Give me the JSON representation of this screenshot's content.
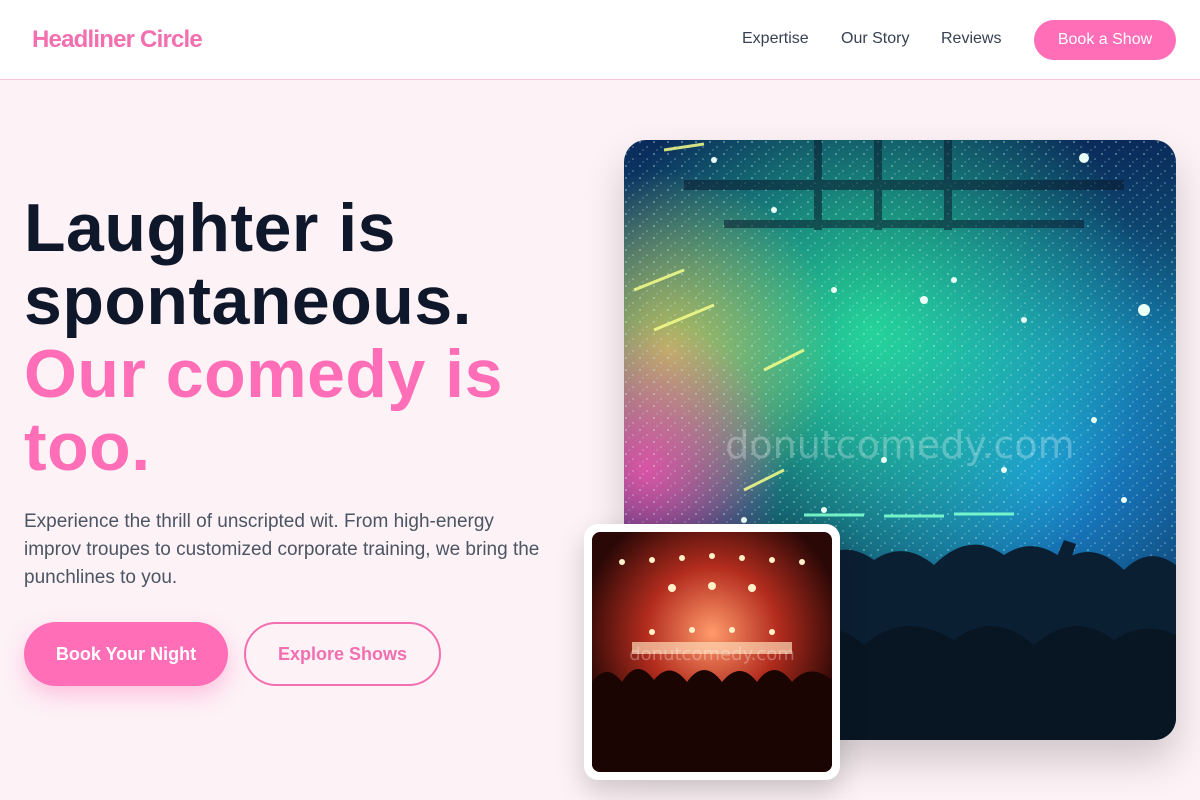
{
  "nav": {
    "brand": "Headliner Circle",
    "links": [
      "Expertise",
      "Our Story",
      "Reviews"
    ],
    "cta": "Book a Show"
  },
  "hero": {
    "headline_line1": "Laughter is",
    "headline_line2": "spontaneous.",
    "headline_accent1": "Our comedy is",
    "headline_accent2": "too.",
    "subtext": "Experience the thrill of unscripted wit. From high-energy improv troupes to customized corporate training, we bring the punchlines to you.",
    "primary_button": "Book Your Night",
    "secondary_button": "Explore Shows"
  },
  "images": {
    "main_alt": "Concert crowd with confetti and stage lights",
    "main_watermark": "donutcomedy.com",
    "inset_alt": "Audience watching a stage show",
    "inset_watermark": "donutcomedy.com"
  },
  "colors": {
    "accent": "#ff6eb6",
    "brand": "#f26fb0",
    "heading": "#0f172a",
    "body_text": "#4b5563",
    "page_bg": "#fdf2f6"
  }
}
